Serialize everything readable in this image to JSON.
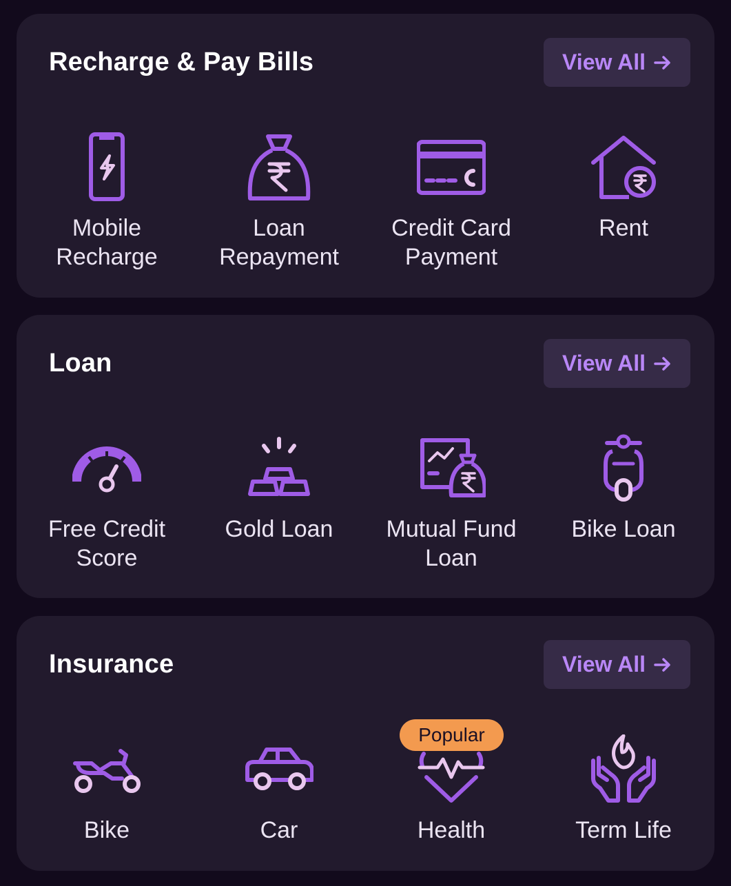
{
  "sections": [
    {
      "title": "Recharge & Pay Bills",
      "view_all": "View All",
      "items": [
        {
          "label": "Mobile\nRecharge",
          "icon": "mobile-recharge-icon"
        },
        {
          "label": "Loan\nRepayment",
          "icon": "money-bag-rupee-icon"
        },
        {
          "label": "Credit Card\nPayment",
          "icon": "credit-card-icon"
        },
        {
          "label": "Rent",
          "icon": "house-rupee-icon"
        }
      ]
    },
    {
      "title": "Loan",
      "view_all": "View All",
      "items": [
        {
          "label": "Free Credit\nScore",
          "icon": "speedometer-icon"
        },
        {
          "label": "Gold Loan",
          "icon": "gold-bars-icon"
        },
        {
          "label": "Mutual Fund\nLoan",
          "icon": "mutual-fund-icon"
        },
        {
          "label": "Bike Loan",
          "icon": "scooter-icon"
        }
      ]
    },
    {
      "title": "Insurance",
      "view_all": "View All",
      "badge": "Popular",
      "items": [
        {
          "label": "Bike",
          "icon": "motorbike-icon"
        },
        {
          "label": "Car",
          "icon": "car-icon"
        },
        {
          "label": "Health",
          "icon": "heart-pulse-icon"
        },
        {
          "label": "Term Life",
          "icon": "hands-flame-icon"
        }
      ]
    }
  ],
  "colors": {
    "background": "#120a1c",
    "card": "#221a2d",
    "button": "#362b47",
    "accent": "#b987f7",
    "icon_primary": "#9f5ce6",
    "icon_secondary": "#e9c7ee",
    "badge": "#f39a4f"
  }
}
